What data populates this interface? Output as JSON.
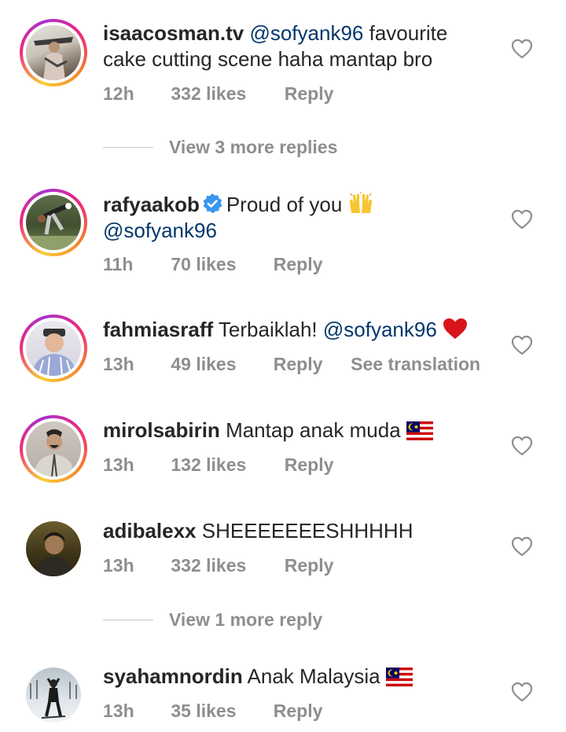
{
  "comments": [
    {
      "username": "isaacosman.tv",
      "mention": "@sofyank96",
      "text": "favourite",
      "text2": "cake cutting scene haha mantap bro",
      "time": "12h",
      "likes": "332 likes",
      "reply": "Reply"
    },
    {
      "username": "rafyaakob",
      "text": "Proud of you",
      "mention": "@sofyank96",
      "time": "11h",
      "likes": "70 likes",
      "reply": "Reply"
    },
    {
      "username": "fahmiasraff",
      "text": "Terbaiklah!",
      "mention": "@sofyank96",
      "time": "13h",
      "likes": "49 likes",
      "reply": "Reply",
      "translate": "See translation"
    },
    {
      "username": "mirolsabirin",
      "text": "Mantap anak muda",
      "time": "13h",
      "likes": "132 likes",
      "reply": "Reply"
    },
    {
      "username": "adibalexx",
      "text": "SHEEEEEEESHHHHH",
      "time": "13h",
      "likes": "332 likes",
      "reply": "Reply"
    },
    {
      "username": "syahamnordin",
      "text": "Anak Malaysia",
      "time": "13h",
      "likes": "35 likes",
      "reply": "Reply"
    }
  ],
  "view_more": [
    "View 3 more replies",
    "View 1 more reply"
  ],
  "icons": {
    "heart": "heart-outline-icon",
    "verified": "verified-badge-icon",
    "emoji_hands": "raising-hands-emoji",
    "emoji_heart": "red-heart-emoji",
    "emoji_flag": "malaysia-flag-emoji"
  },
  "colors": {
    "mention": "#00376b",
    "meta": "#8e8e8e",
    "verified": "#3897f0"
  }
}
